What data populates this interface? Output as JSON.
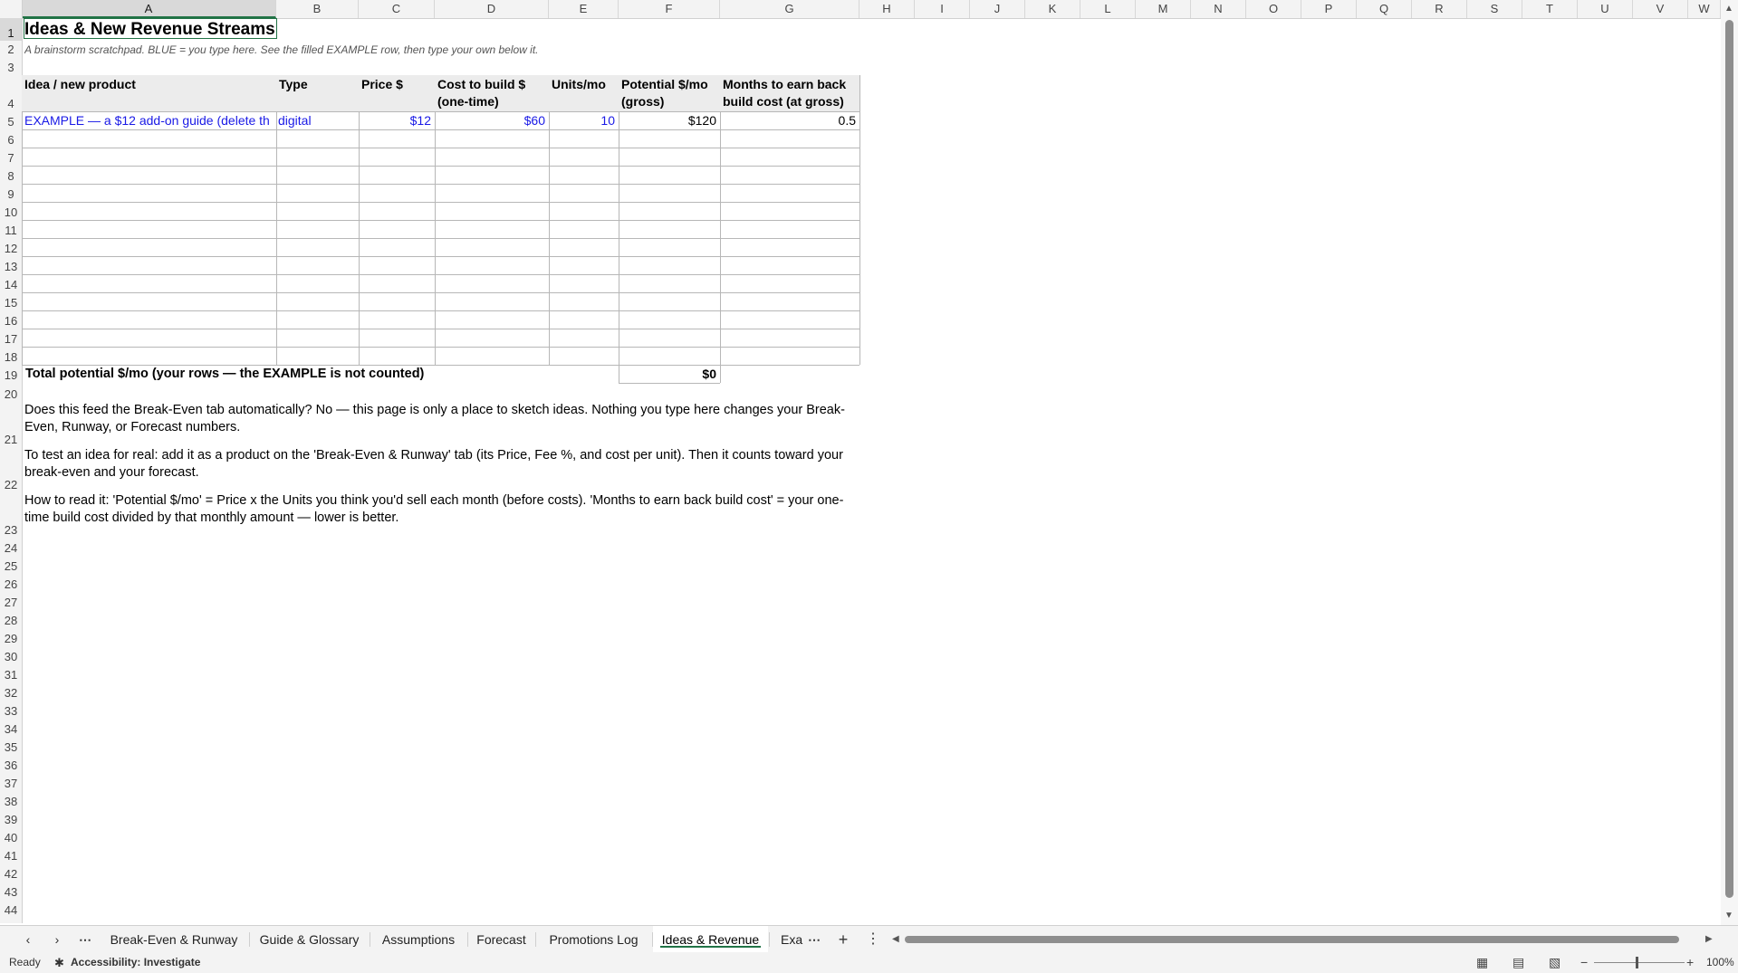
{
  "columns": [
    "A",
    "B",
    "C",
    "D",
    "E",
    "F",
    "G",
    "H",
    "I",
    "J",
    "K",
    "L",
    "M",
    "N",
    "O",
    "P",
    "Q",
    "R",
    "S",
    "T",
    "U",
    "V",
    "W"
  ],
  "rows": [
    "1",
    "2",
    "3",
    "4",
    "5",
    "6",
    "7",
    "8",
    "9",
    "10",
    "11",
    "12",
    "13",
    "14",
    "15",
    "16",
    "17",
    "18",
    "19",
    "20",
    "21",
    "22",
    "23",
    "24",
    "25",
    "26",
    "27",
    "28",
    "29",
    "30",
    "31",
    "32",
    "33",
    "34",
    "35",
    "36",
    "37",
    "38",
    "39",
    "40",
    "41",
    "42",
    "43",
    "44"
  ],
  "sheet": {
    "title": "Ideas & New Revenue Streams",
    "subtitle": "A brainstorm scratchpad. BLUE = you type here. See the filled EXAMPLE row, then type your own below it.",
    "headers": [
      "Idea / new product",
      "Type",
      "Price $",
      "Cost to build $ (one-time)",
      "Units/mo",
      "Potential $/mo (gross)",
      "Months to earn back build cost (at gross)"
    ],
    "example_row": [
      "EXAMPLE — a $12 add-on guide (delete th",
      "digital",
      "$12",
      "$60",
      "10",
      "$120",
      "0.5"
    ],
    "total_label": "Total potential $/mo (your rows — the EXAMPLE is not counted)",
    "total_value": "$0",
    "note1": "Does this feed the Break-Even tab automatically?  No — this page is only a place to sketch ideas. Nothing you type here changes your Break-Even, Runway, or Forecast numbers.",
    "note2": "To test an idea for real: add it as a product on the 'Break-Even & Runway' tab (its Price, Fee %, and cost per unit). Then it counts toward your break-even and your forecast.",
    "note3": "How to read it:  'Potential $/mo' = Price x the Units you think you'd sell each month (before costs).  'Months to earn back build cost' = your one-time build cost divided by that monthly amount — lower is better."
  },
  "tabs": {
    "items": [
      "Break-Even & Runway",
      "Guide & Glossary",
      "Assumptions",
      "Forecast",
      "Promotions Log",
      "Ideas & Revenue",
      "Exa"
    ],
    "active": "Ideas & Revenue"
  },
  "status": {
    "ready": "Ready",
    "accessibility": "Accessibility: Investigate",
    "zoom": "100%"
  },
  "colors": {
    "accent": "#217346",
    "input_blue": "#1a1ae6"
  }
}
